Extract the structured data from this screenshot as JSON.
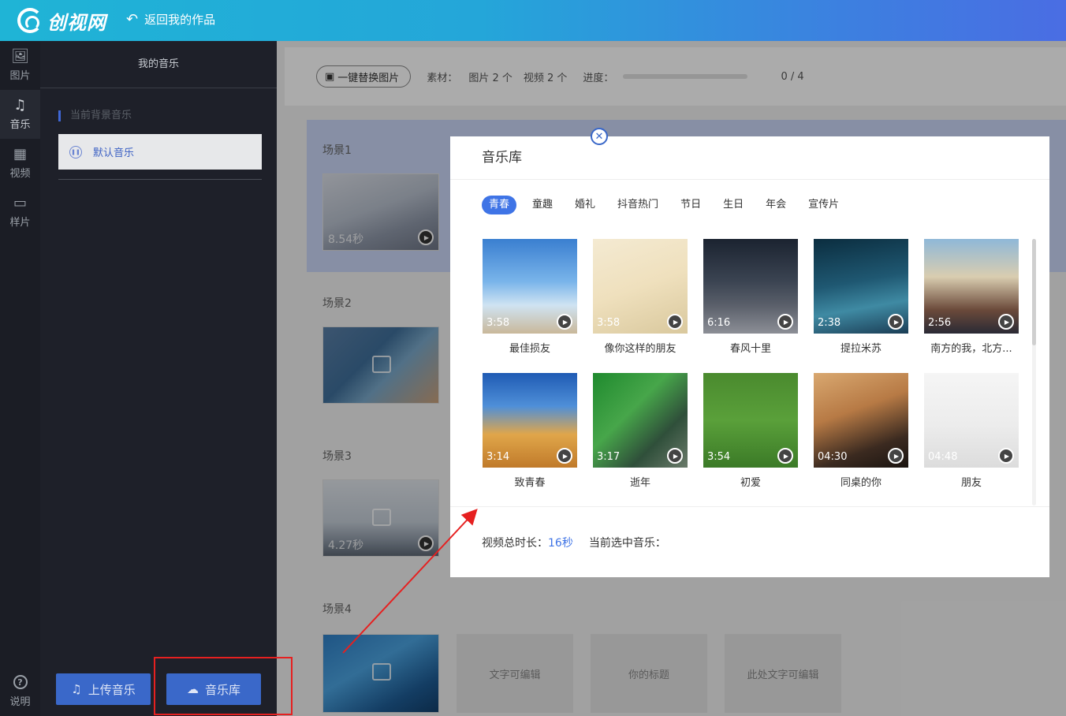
{
  "app": {
    "logo_text": "创视网",
    "back_label": "返回我的作品"
  },
  "rail": {
    "items": [
      {
        "label": "图片",
        "icon": "image-icon"
      },
      {
        "label": "音乐",
        "icon": "music-note-icon"
      },
      {
        "label": "视频",
        "icon": "film-icon"
      },
      {
        "label": "样片",
        "icon": "laptop-icon"
      }
    ],
    "help_label": "说明"
  },
  "music_panel": {
    "title": "我的音乐",
    "section_label": "当前背景音乐",
    "current_music": "默认音乐",
    "upload_button": "上传音乐",
    "library_button": "音乐库"
  },
  "toolbar": {
    "replace_button": "一键替换图片",
    "material_label": "素材：",
    "images": "图片 2 个",
    "videos": "视频 2 个",
    "progress_label": "进度：",
    "progress_value": 0,
    "progress_text": "0 / 4"
  },
  "scenes": [
    {
      "label": "场景1",
      "duration": "8.54秒"
    },
    {
      "label": "场景2",
      "duration": ""
    },
    {
      "label": "场景3",
      "duration": "4.27秒"
    },
    {
      "label": "场景4",
      "duration": ""
    }
  ],
  "scene4_text_boxes": [
    "文字可编辑",
    "你的标题",
    "此处文字可编辑"
  ],
  "modal": {
    "title": "音乐库",
    "tabs": [
      "青春",
      "童趣",
      "婚礼",
      "抖音热门",
      "节日",
      "生日",
      "年会",
      "宣传片"
    ],
    "active_tab": "青春",
    "songs": [
      {
        "name": "最佳损友",
        "duration": "3:58"
      },
      {
        "name": "像你这样的朋友",
        "duration": "3:58"
      },
      {
        "name": "春风十里",
        "duration": "6:16"
      },
      {
        "name": "提拉米苏",
        "duration": "2:38"
      },
      {
        "name": "南方的我，北方...",
        "duration": "2:56"
      },
      {
        "name": "致青春",
        "duration": "3:14"
      },
      {
        "name": "逝年",
        "duration": "3:17"
      },
      {
        "name": "初爱",
        "duration": "3:54"
      },
      {
        "name": "同桌的你",
        "duration": "04:30"
      },
      {
        "name": "朋友",
        "duration": "04:48"
      }
    ],
    "footer": {
      "total_label": "视频总时长：",
      "total_value": "16秒",
      "current_label": "当前选中音乐："
    }
  },
  "colors": {
    "accent": "#3f74e6",
    "annotation": "#e62020"
  }
}
